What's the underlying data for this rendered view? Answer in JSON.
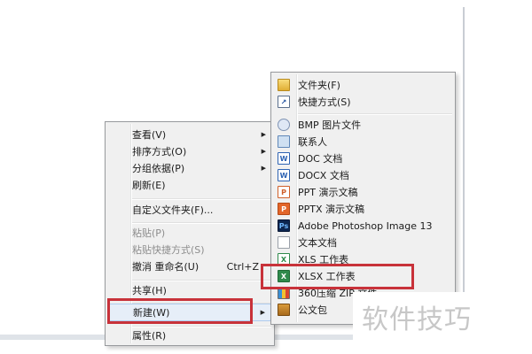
{
  "context_menu": {
    "view": "查看(V)",
    "sort_by": "排序方式(O)",
    "group_by": "分组依据(P)",
    "refresh": "刷新(E)",
    "customize_folder": "自定义文件夹(F)...",
    "paste": "粘贴(P)",
    "paste_shortcut": "粘贴快捷方式(S)",
    "undo_rename": "撤消 重命名(U)",
    "undo_rename_accel": "Ctrl+Z",
    "share": "共享(H)",
    "new": "新建(W)",
    "properties": "属性(R)"
  },
  "new_submenu": {
    "items": [
      {
        "label": "文件夹(F)",
        "icon": "folder-icon"
      },
      {
        "label": "快捷方式(S)",
        "icon": "shortcut-icon"
      },
      {
        "label": "BMP 图片文件",
        "icon": "bmp-file-icon"
      },
      {
        "label": "联系人",
        "icon": "contact-icon"
      },
      {
        "label": "DOC 文档",
        "icon": "doc-file-icon"
      },
      {
        "label": "DOCX 文档",
        "icon": "docx-file-icon"
      },
      {
        "label": "PPT 演示文稿",
        "icon": "ppt-file-icon"
      },
      {
        "label": "PPTX 演示文稿",
        "icon": "pptx-file-icon"
      },
      {
        "label": "Adobe Photoshop Image 13",
        "icon": "photoshop-file-icon"
      },
      {
        "label": "文本文档",
        "icon": "text-file-icon"
      },
      {
        "label": "XLS 工作表",
        "icon": "xls-file-icon"
      },
      {
        "label": "XLSX 工作表",
        "icon": "xlsx-file-icon"
      },
      {
        "label": "360压缩 ZIP 文件",
        "icon": "zip-file-icon"
      },
      {
        "label": "公文包",
        "icon": "briefcase-icon"
      }
    ]
  },
  "watermark": "软件技巧",
  "colors": {
    "menu_background": "#f0f0f0",
    "menu_border": "#97999c",
    "highlight_box": "#c8323a",
    "disabled_text": "#8d8d8d",
    "watermark_text": "#c7c7c7"
  }
}
